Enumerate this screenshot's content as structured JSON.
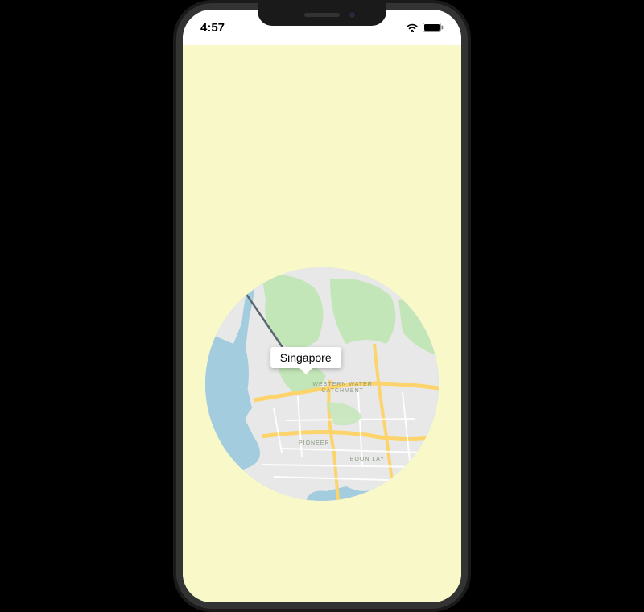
{
  "status": {
    "time": "4:57"
  },
  "map": {
    "info_window_label": "Singapore",
    "districts": {
      "western": "WESTERN WATER\nCATCHMENT",
      "pioneer": "PIONEER",
      "boonlay": "BOON LAY"
    },
    "marker": {
      "color": "#ea4335"
    }
  },
  "colors": {
    "app_bg": "#f8f8c8",
    "water": "#a3ccde",
    "land": "#e8e8e8",
    "park": "#c3e6b8",
    "road_major": "#fcd46b",
    "road_minor": "#ffffff"
  }
}
